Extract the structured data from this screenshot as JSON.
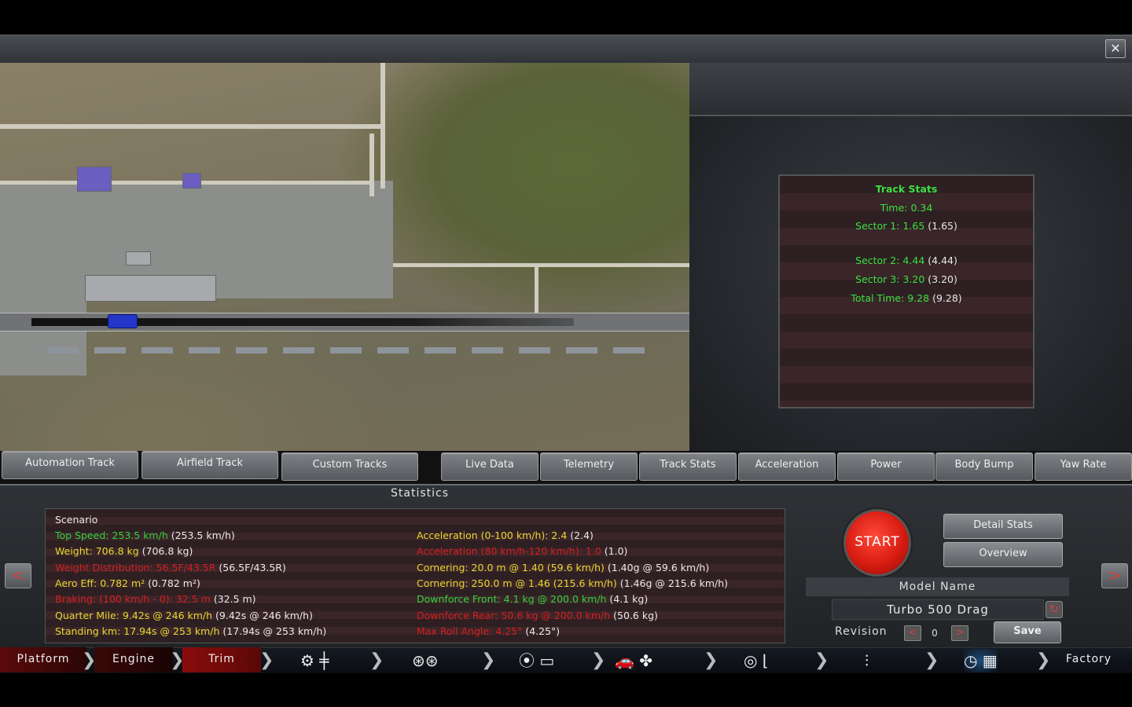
{
  "window": {
    "close_label": "✕"
  },
  "track_stats": {
    "title": "Track Stats",
    "time": "Time: 0.34",
    "sector1": "Sector 1: 1.65",
    "sector1_ref": "(1.65)",
    "sector2": "Sector 2: 4.44",
    "sector2_ref": "(4.44)",
    "sector3": "Sector 3: 3.20",
    "sector3_ref": "(3.20)",
    "total": "Total Time: 9.28",
    "total_ref": "(9.28)"
  },
  "track_tabs": [
    "Automation Track",
    "Airfield Track",
    "Custom Tracks"
  ],
  "view_tabs": [
    "Live Data",
    "Telemetry",
    "Track Stats",
    "Acceleration",
    "Power",
    "Body Bump",
    "Yaw Rate"
  ],
  "statistics": {
    "title": "Statistics",
    "scenario": "Scenario",
    "left": [
      {
        "label": "Top Speed: 253.5 km/h",
        "ref": "(253.5 km/h)",
        "color": "#36d23c"
      },
      {
        "label": "Weight: 706.8 kg",
        "ref": "(706.8 kg)",
        "color": "#e8d830"
      },
      {
        "label": "Weight Distribution: 56.5F/43.5R",
        "ref": "(56.5F/43.5R)",
        "color": "#d81e1e"
      },
      {
        "label": "Aero Eff: 0.782 m²",
        "ref": "(0.782 m²)",
        "color": "#e8d830"
      },
      {
        "label": "Braking: (100 km/h - 0): 32.5 m",
        "ref": "(32.5 m)",
        "color": "#d81e1e"
      },
      {
        "label": "Quarter Mile: 9.42s @ 246 km/h",
        "ref": "(9.42s @ 246 km/h)",
        "color": "#e8d830"
      },
      {
        "label": "Standing km: 17.94s @ 253 km/h",
        "ref": "(17.94s @ 253 km/h)",
        "color": "#e8d830"
      }
    ],
    "right": [
      {
        "label": "Acceleration (0-100 km/h): 2.4",
        "ref": "(2.4)",
        "color": "#e8d830"
      },
      {
        "label": "Acceleration (80 km/h-120 km/h): 1.0",
        "ref": "(1.0)",
        "color": "#d81e1e"
      },
      {
        "label": "Cornering: 20.0 m @ 1.40 (59.6 km/h)",
        "ref": "(1.40g @ 59.6 km/h)",
        "color": "#e8d830"
      },
      {
        "label": "Cornering: 250.0 m @ 1.46 (215.6 km/h)",
        "ref": "(1.46g @ 215.6 km/h)",
        "color": "#e8d830"
      },
      {
        "label": "Downforce Front: 4.1 kg @ 200.0 km/h",
        "ref": "(4.1 kg)",
        "color": "#36d23c"
      },
      {
        "label": "Downforce Rear: 50.6 kg @ 200.0 km/h",
        "ref": "(50.6 kg)",
        "color": "#d81e1e"
      },
      {
        "label": "Max Roll Angle: 4.25°",
        "ref": "(4.25°)",
        "color": "#d81e1e"
      }
    ]
  },
  "controls": {
    "prev": "<",
    "next": ">",
    "start": "START",
    "detail_stats": "Detail Stats",
    "overview": "Overview",
    "model_name_label": "Model Name",
    "model_name": "Turbo 500 Drag",
    "revision_label": "Revision",
    "revision_value": "0",
    "rev_prev": "<",
    "rev_next": ">",
    "save": "Save"
  },
  "footer": {
    "platform": "Platform",
    "engine": "Engine",
    "trim": "Trim",
    "factory": "Factory",
    "icons": [
      "gearbox-icon",
      "wheels-icon",
      "brakes-body-icon",
      "car-aero-icon",
      "interior-icon",
      "suspension-icon",
      "testing-icon"
    ]
  }
}
